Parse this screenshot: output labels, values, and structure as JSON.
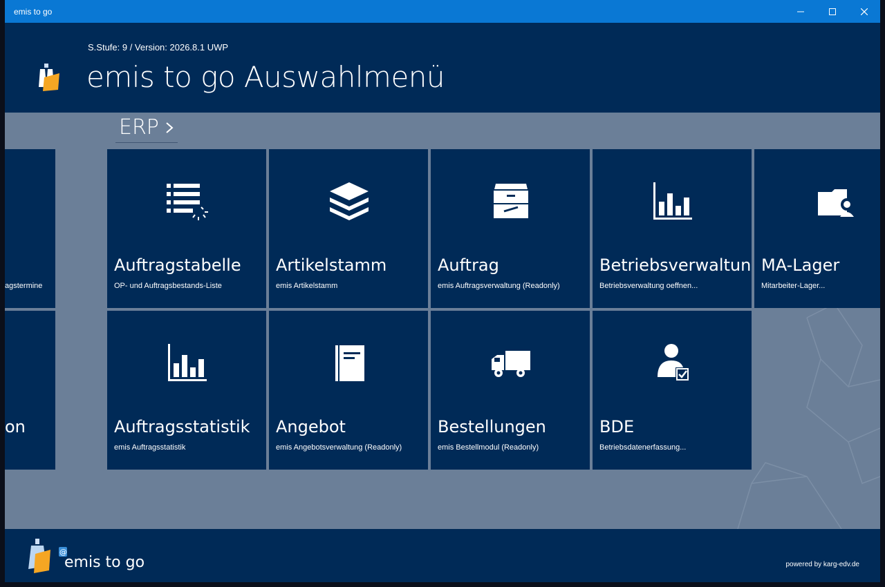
{
  "window": {
    "title": "emis to go"
  },
  "header": {
    "version_label": "S.Stufe: 9 / Version: 2026.8.1 UWP",
    "title": "emis to go Auswahlmenü"
  },
  "section": {
    "title": "ERP"
  },
  "left_partial_tiles": [
    {
      "subtitle_fragment": "agstermine"
    },
    {
      "title_fragment": "on"
    }
  ],
  "tiles": [
    {
      "icon": "list-icon",
      "title": "Auftragstabelle",
      "subtitle": "OP- und Auftragsbestands-Liste"
    },
    {
      "icon": "layers-icon",
      "title": "Artikelstamm",
      "subtitle": "emis Artikelstamm"
    },
    {
      "icon": "archive-drawer-icon",
      "title": "Auftrag",
      "subtitle": "emis Auftragsverwaltung (Readonly)"
    },
    {
      "icon": "bar-chart-icon",
      "title": "Betriebsverwaltung",
      "subtitle": "Betriebsverwaltung oeffnen..."
    },
    {
      "icon": "folder-user-icon",
      "title": "MA-Lager",
      "subtitle": "Mitarbeiter-Lager..."
    },
    {
      "icon": "bar-chart-icon",
      "title": "Auftragsstatistik",
      "subtitle": "emis Auftragsstatistik"
    },
    {
      "icon": "book-icon",
      "title": "Angebot",
      "subtitle": "emis Angebotsverwaltung (Readonly)"
    },
    {
      "icon": "truck-icon",
      "title": "Bestellungen",
      "subtitle": "emis Bestellmodul (Readonly)"
    },
    {
      "icon": "user-check-icon",
      "title": "BDE",
      "subtitle": "Betriebsdatenerfassung..."
    }
  ],
  "footer": {
    "brand": "emis to go",
    "powered": "powered by karg-edv.de"
  },
  "colors": {
    "titlebar": "#0a78d4",
    "tile": "#002a57",
    "background": "#6b7f98",
    "accent": "#f5a623"
  }
}
